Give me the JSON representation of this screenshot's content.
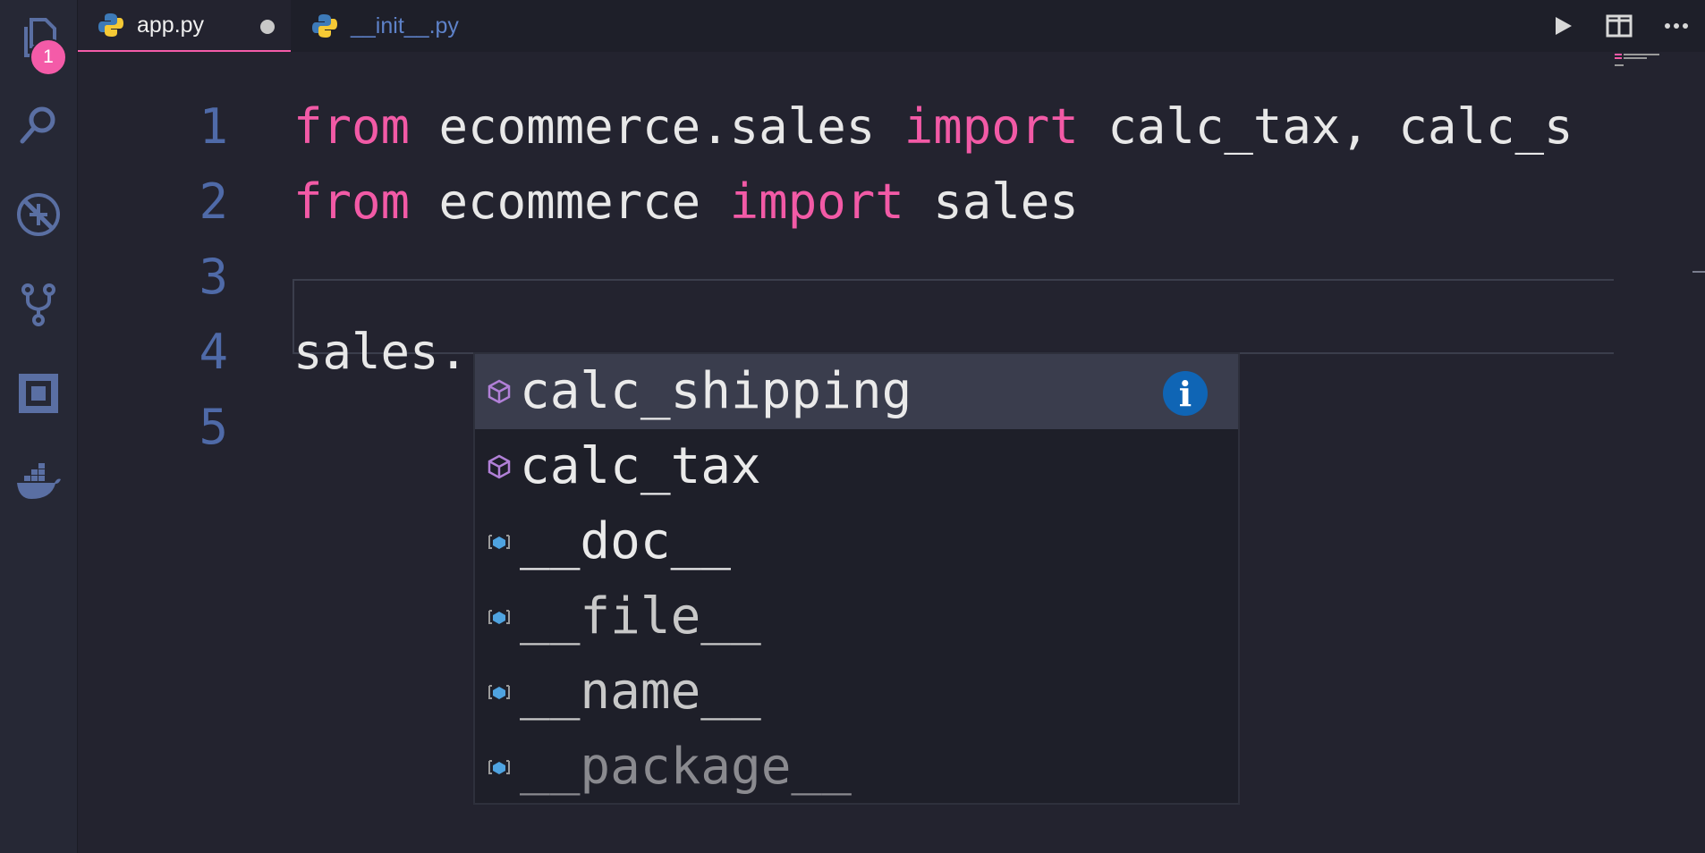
{
  "activity_bar": {
    "explorer_badge": "1",
    "items": [
      "explorer-icon",
      "search-icon",
      "debug-icon",
      "source-control-icon",
      "remote-explorer-icon",
      "docker-icon"
    ]
  },
  "tabs": [
    {
      "label": "app.py",
      "icon": "python-icon",
      "active": true,
      "modified": true
    },
    {
      "label": "__init__.py",
      "icon": "python-icon",
      "active": false,
      "modified": false
    }
  ],
  "toolbar": [
    "run-icon",
    "split-editor-icon",
    "more-actions-icon"
  ],
  "editor": {
    "lines": [
      {
        "number": "1",
        "tokens": [
          {
            "t": "from",
            "k": "kw"
          },
          {
            "t": " ecommerce.sales ",
            "k": "id"
          },
          {
            "t": "import",
            "k": "kw"
          },
          {
            "t": " calc_tax, calc_s",
            "k": "id"
          }
        ]
      },
      {
        "number": "2",
        "tokens": [
          {
            "t": "from",
            "k": "kw"
          },
          {
            "t": " ecommerce ",
            "k": "id"
          },
          {
            "t": "import",
            "k": "kw"
          },
          {
            "t": " sales",
            "k": "id"
          }
        ]
      },
      {
        "number": "3",
        "tokens": []
      },
      {
        "number": "4",
        "tokens": [
          {
            "t": "sales.",
            "k": "id"
          }
        ]
      },
      {
        "number": "5",
        "tokens": []
      }
    ]
  },
  "suggestions": [
    {
      "label": "calc_shipping",
      "kind": "module-icon",
      "selected": true
    },
    {
      "label": "calc_tax",
      "kind": "module-icon",
      "selected": false
    },
    {
      "label": "__doc__",
      "kind": "variable-icon",
      "selected": false
    },
    {
      "label": "__file__",
      "kind": "variable-icon",
      "selected": false
    },
    {
      "label": "__name__",
      "kind": "variable-icon",
      "selected": false
    },
    {
      "label": "__package__",
      "kind": "variable-icon",
      "selected": false
    }
  ],
  "suggest_info_glyph": "i",
  "colors": {
    "keyword": "#f25aa6",
    "identifier": "#e8e8e8",
    "line_number": "#4f6aa8",
    "accent": "#f45ba8",
    "info_button": "#0f65b5"
  }
}
